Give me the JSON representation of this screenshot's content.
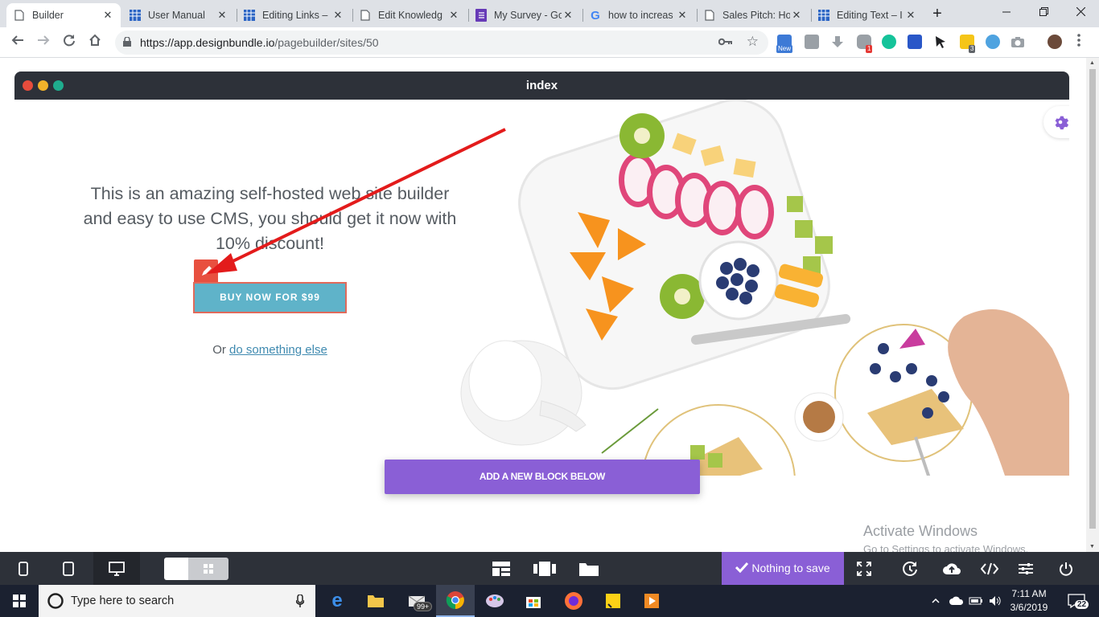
{
  "browser": {
    "tabs": [
      {
        "title": "Builder",
        "icon": "page-icon",
        "active": true
      },
      {
        "title": "User Manual",
        "icon": "grid-app-icon"
      },
      {
        "title": "Editing Links –",
        "icon": "grid-app-icon"
      },
      {
        "title": "Edit Knowledg",
        "icon": "page-icon"
      },
      {
        "title": "My Survey - Go",
        "icon": "forms-icon"
      },
      {
        "title": "how to increas",
        "icon": "google-icon"
      },
      {
        "title": "Sales Pitch: Ho",
        "icon": "page-icon"
      },
      {
        "title": "Editing Text – I",
        "icon": "grid-app-icon"
      }
    ],
    "close_glyph": "✕",
    "new_tab_glyph": "+",
    "url_host": "https://app.designbundle.io",
    "url_path": "/pagebuilder/sites/50",
    "extension_badges": {
      "new": "New",
      "red": "1",
      "yellow": "3"
    }
  },
  "builder": {
    "frame_title": "index",
    "hero_text": "This is an amazing self-hosted web site builder and easy to use CMS, you should get it now with 10% discount!",
    "buy_button": "BUY NOW FOR $99",
    "or_prefix": "Or ",
    "or_link": "do something else",
    "add_block_button": "ADD A NEW BLOCK BELOW",
    "save_status": "Nothing to save",
    "colors": {
      "accent": "#8a5fd6",
      "cta": "#5fb3c9",
      "edit": "#e8503f",
      "dark_bar": "#2d3139"
    }
  },
  "watermark": {
    "line1": "Activate Windows",
    "line2": "Go to Settings to activate Windows."
  },
  "taskbar": {
    "search_placeholder": "Type here to search",
    "mail_badge": "99+",
    "time": "7:11 AM",
    "date": "3/6/2019",
    "notification_count": "22"
  }
}
